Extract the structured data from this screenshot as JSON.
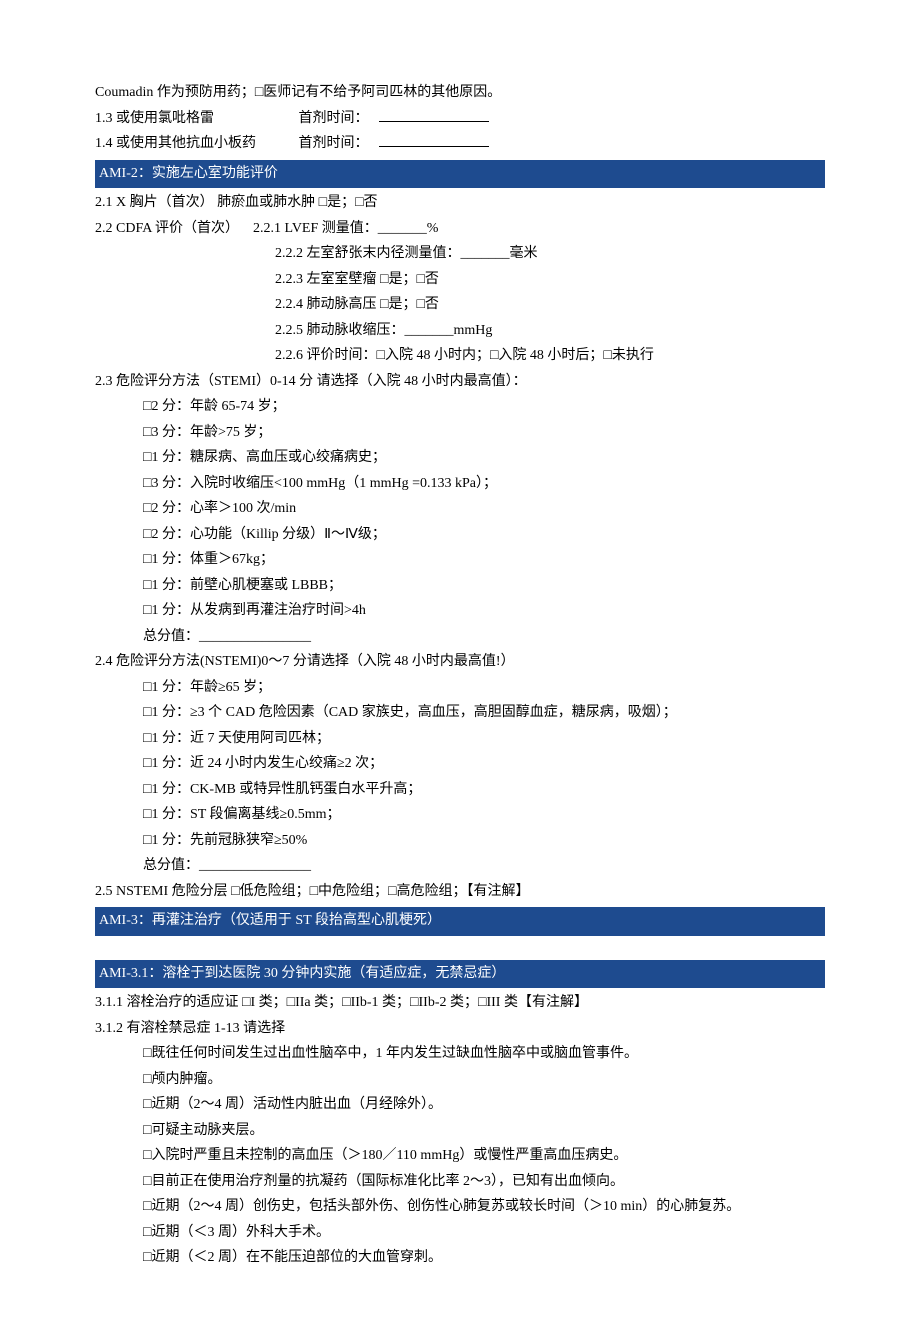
{
  "pre": {
    "coumadin": "Coumadin 作为预防用药；□医师记有不给予阿司匹林的其他原因。",
    "l13_label": "1.3  或使用氯吡格雷",
    "l13_time": "首剂时间：",
    "l14_label": "1.4  或使用其他抗血小板药",
    "l14_time": "首剂时间："
  },
  "ami2": {
    "header": "AMI-2：实施左心室功能评价",
    "l21": "2.1 X 胸片（首次）   肺瘀血或肺水肿  □是；□否",
    "l22_lead": "2.2 CDFA 评价（首次）",
    "l221": "2.2.1 LVEF 测量值：_______%",
    "l222": "2.2.2 左室舒张末内径测量值：_______毫米",
    "l223": "2.2.3 左室室壁瘤   □是；□否",
    "l224": "2.2.4 肺动脉高压   □是；□否",
    "l225": "2.2.5 肺动脉收缩压：_______mmHg",
    "l226": "2.2.6 评价时间：□入院 48 小时内；□入院 48 小时后；□未执行",
    "l23_lead": "2.3  危险评分方法（STEMI）0-14 分  请选择（入院 48 小时内最高值）：",
    "s1": "□2 分：年龄 65-74 岁；",
    "s2": "□3 分：年龄>75 岁；",
    "s3": "□1 分：糖尿病、高血压或心绞痛病史；",
    "s4": "□3 分：入院时收缩压<100 mmHg（1 mmHg =0.133 kPa）；",
    "s5": "□2 分：心率＞100 次/min",
    "s6": "□2 分：心功能（Killip  分级）Ⅱ～Ⅳ级；",
    "s7": "□1 分：体重＞67kg；",
    "s8": "□1 分：前壁心肌梗塞或 LBBB；",
    "s9": "□1 分：从发病到再灌注治疗时间>4h",
    "stotal": "总分值：________________",
    "l24_lead": "2.4  危险评分方法(NSTEMI)0～7 分请选择（入院 48 小时内最高值!）",
    "n1": "□1 分：年龄≥65  岁；",
    "n2": "□1 分：≥3 个 CAD 危险因素（CAD 家族史，高血压，高胆固醇血症，糖尿病，吸烟）；",
    "n3": "□1 分：近 7 天使用阿司匹林；",
    "n4": "□1 分：近 24 小时内发生心绞痛≥2 次；",
    "n5": "□1 分：CK-MB 或特异性肌钙蛋白水平升高；",
    "n6": "□1 分：ST 段偏离基线≥0.5mm；",
    "n7": "□1 分：先前冠脉狭窄≥50%",
    "ntotal": "总分值：________________",
    "l25": "2.5 NSTEMI 危险分层   □低危险组；□中危险组；□高危险组；【有注解】"
  },
  "ami3": {
    "header": "AMI-3：再灌注治疗（仅适用于 ST 段抬高型心肌梗死）"
  },
  "ami31": {
    "header": "AMI-3.1：溶栓于到达医院 30 分钟内实施（有适应症，无禁忌症）",
    "l311": "3.1.1 溶栓治疗的适应证     □I 类；□IIa 类；□IIb-1 类；□IIb-2 类；□III 类【有注解】",
    "l312": "3.1.2 有溶栓禁忌症 1-13    请选择",
    "c1": "□既往任何时间发生过出血性脑卒中，1 年内发生过缺血性脑卒中或脑血管事件。",
    "c2": "□颅内肿瘤。",
    "c3": "□近期（2～4 周）活动性内脏出血（月经除外）。",
    "c4": "□可疑主动脉夹层。",
    "c5": "□入院时严重且未控制的高血压（＞180／110 mmHg）或慢性严重高血压病史。",
    "c6": "□目前正在使用治疗剂量的抗凝药（国际标准化比率 2～3），已知有出血倾向。",
    "c7": "□近期（2～4 周）创伤史，包括头部外伤、创伤性心肺复苏或较长时间（＞10 min）的心肺复苏。",
    "c8": "□近期（＜3 周）外科大手术。",
    "c9": "□近期（＜2 周）在不能压迫部位的大血管穿刺。"
  }
}
